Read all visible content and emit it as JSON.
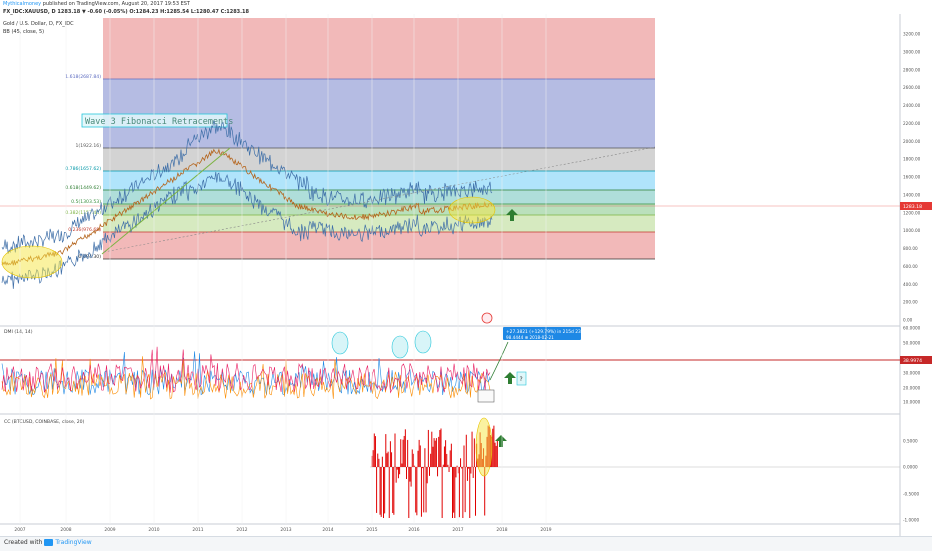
{
  "header": {
    "author": "Mythicalmoney",
    "published": "published on TradingView.com, August 20, 2017 19:53 EST",
    "symbol_line": "FX_IDC:XAUUSD, D  1283.18 ▼ -0.60 (-0.05%)  O:1284.23  H:1285.54  L:1280.47  C:1283.18",
    "subtitle": "Gold / U.S. Dollar, D, FX_IDC",
    "indicator": "BB (45, close, 5)"
  },
  "price_axis": {
    "ticks": [
      "3200.00",
      "3000.00",
      "2800.00",
      "2600.00",
      "2400.00",
      "2200.00",
      "2000.00",
      "1800.00",
      "1600.00",
      "1400.00",
      "1200.00",
      "1000.00",
      "800.00",
      "600.00",
      "400.00",
      "200.00",
      "0.00"
    ],
    "current": "1283.18"
  },
  "fib_levels": [
    {
      "label": "1.618(2687.84)",
      "color": "#5c6bc0"
    },
    {
      "label": "1(1922.16)",
      "color": "#555555"
    },
    {
      "label": "0.786(1657.62)",
      "color": "#0097a7"
    },
    {
      "label": "0.618(1449.62)",
      "color": "#2e7d32"
    },
    {
      "label": "0.5(1303.53)",
      "color": "#388e3c"
    },
    {
      "label": "0.382(1157.44)",
      "color": "#7cb342"
    },
    {
      "label": "0.236(976.68)",
      "color": "#c0392b"
    },
    {
      "label": "0(684.30)",
      "color": "#333333"
    }
  ],
  "annotation_text": "Wave 3 Fibonacci Retracements",
  "dmi_panel": {
    "title": "DMI (14, 14)",
    "ticks": [
      "60.0000",
      "50.0000",
      "40.0000",
      "30.0000",
      "20.0000",
      "10.0000"
    ],
    "current": "38.9974",
    "callout_line1": "+27.3821 (+129.79%) in 215d 23h",
    "callout_line2": "98.4444  ⊕ 2018-02-21",
    "question": "?"
  },
  "cc_panel": {
    "title": "CC (BTCUSD, COINBASE, close, 20)",
    "ticks": [
      "0.5000",
      "0.0000",
      "-0.5000",
      "-1.0000"
    ]
  },
  "time_axis": [
    "2007",
    "2008",
    "2009",
    "2010",
    "2011",
    "2012",
    "2013",
    "2014",
    "2015",
    "2016",
    "2017",
    "2018",
    "2019"
  ],
  "footer": {
    "created_with": "Created with",
    "brand": "TradingView"
  },
  "colors": {
    "accent": "#2196f3",
    "price_line": "#e53935",
    "up_arrow": "#2e7d32",
    "highlight": "#f5e642",
    "cc_bars": "#e00000"
  }
}
